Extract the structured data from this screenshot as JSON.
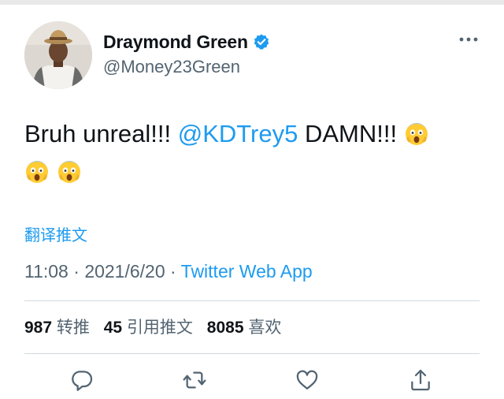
{
  "author": {
    "display_name": "Draymond Green",
    "handle": "@Money23Green",
    "verified": true
  },
  "tweet": {
    "text_before": "Bruh unreal!!! ",
    "mention": "@KDTrey5",
    "text_after": " DAMN!!! ",
    "emoji_name": "face-screaming-in-fear",
    "emoji_count": 3
  },
  "translate_label": "翻译推文",
  "meta": {
    "time": "11:08",
    "separator": " · ",
    "date": "2021/6/20",
    "source": "Twitter Web App"
  },
  "stats": {
    "retweets_count": "987",
    "retweets_label": "转推",
    "quotes_count": "45",
    "quotes_label": "引用推文",
    "likes_count": "8085",
    "likes_label": "喜欢"
  },
  "colors": {
    "accent": "#1d9bf0",
    "secondary_text": "#536471",
    "primary_text": "#0f1419",
    "divider": "#cfd9de"
  },
  "icons": [
    "verified-badge-icon",
    "more-options-icon",
    "reply-icon",
    "retweet-icon",
    "like-icon",
    "share-icon"
  ]
}
